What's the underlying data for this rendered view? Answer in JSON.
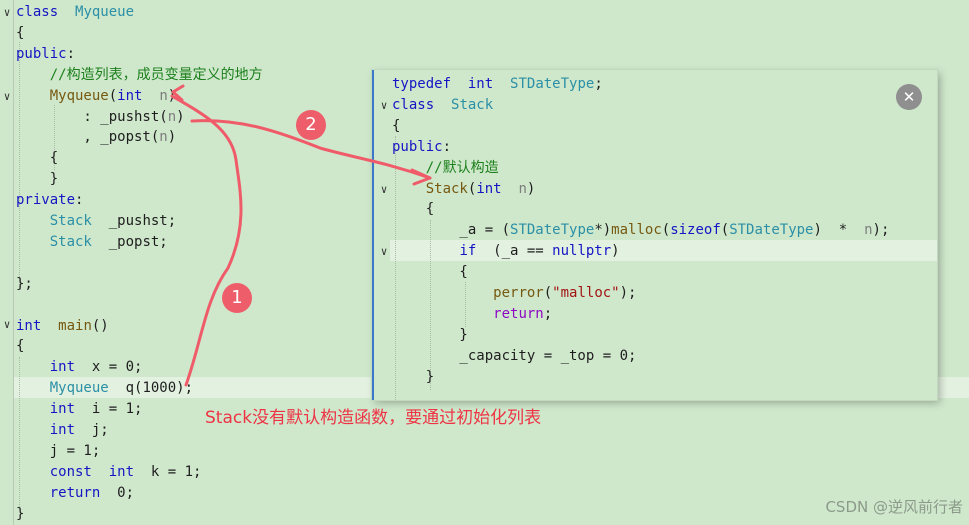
{
  "main_editor": {
    "lines": [
      {
        "parts": [
          [
            "kw",
            "class"
          ],
          [
            "",
            "  "
          ],
          [
            "ty",
            "Myqueue"
          ]
        ]
      },
      {
        "parts": [
          [
            "",
            "{"
          ]
        ]
      },
      {
        "parts": [
          [
            "kw",
            "public"
          ],
          [
            "",
            ":"
          ]
        ]
      },
      {
        "parts": [
          [
            "",
            "    "
          ],
          [
            "cm",
            "//构造列表，成员变量定义的地方"
          ]
        ]
      },
      {
        "parts": [
          [
            "",
            "    "
          ],
          [
            "fn",
            "Myqueue"
          ],
          [
            "",
            "("
          ],
          [
            "kw",
            "int"
          ],
          [
            "",
            "  "
          ],
          [
            "pr",
            "n"
          ],
          [
            "",
            ")"
          ]
        ]
      },
      {
        "parts": [
          [
            "",
            "        : _pushst("
          ],
          [
            "pr",
            "n"
          ],
          [
            "",
            ")"
          ]
        ]
      },
      {
        "parts": [
          [
            "",
            "        , _popst("
          ],
          [
            "pr",
            "n"
          ],
          [
            "",
            ")"
          ]
        ]
      },
      {
        "parts": [
          [
            "",
            "    {"
          ]
        ]
      },
      {
        "parts": [
          [
            "",
            "    }"
          ]
        ]
      },
      {
        "parts": [
          [
            "kw",
            "private"
          ],
          [
            "",
            ":"
          ]
        ]
      },
      {
        "parts": [
          [
            "",
            "    "
          ],
          [
            "ty",
            "Stack"
          ],
          [
            "",
            "  _pushst;"
          ]
        ]
      },
      {
        "parts": [
          [
            "",
            "    "
          ],
          [
            "ty",
            "Stack"
          ],
          [
            "",
            "  _popst;"
          ]
        ]
      },
      {
        "parts": [
          [
            "",
            ""
          ]
        ]
      },
      {
        "parts": [
          [
            "",
            "};"
          ]
        ]
      },
      {
        "parts": [
          [
            "",
            ""
          ]
        ]
      },
      {
        "parts": [
          [
            "kw",
            "int"
          ],
          [
            "",
            "  "
          ],
          [
            "fn",
            "main"
          ],
          [
            "",
            "()"
          ]
        ]
      },
      {
        "parts": [
          [
            "",
            "{"
          ]
        ]
      },
      {
        "parts": [
          [
            "",
            "    "
          ],
          [
            "kw",
            "int"
          ],
          [
            "",
            "  x = 0;"
          ]
        ]
      },
      {
        "parts": [
          [
            "",
            "    "
          ],
          [
            "ty",
            "Myqueue"
          ],
          [
            "",
            "  q(1000);"
          ]
        ]
      },
      {
        "parts": [
          [
            "",
            "    "
          ],
          [
            "kw",
            "int"
          ],
          [
            "",
            "  i = 1;"
          ]
        ]
      },
      {
        "parts": [
          [
            "",
            "    "
          ],
          [
            "kw",
            "int"
          ],
          [
            "",
            "  j;"
          ]
        ]
      },
      {
        "parts": [
          [
            "",
            "    j = 1;"
          ]
        ]
      },
      {
        "parts": [
          [
            "",
            "    "
          ],
          [
            "kw",
            "const"
          ],
          [
            "",
            "  "
          ],
          [
            "kw",
            "int"
          ],
          [
            "",
            "  k = 1;"
          ]
        ]
      },
      {
        "parts": [
          [
            "",
            "    "
          ],
          [
            "kw",
            "return"
          ],
          [
            "",
            "  0;"
          ]
        ]
      },
      {
        "parts": [
          [
            "",
            "}"
          ]
        ]
      }
    ]
  },
  "peek_window": {
    "lines": [
      {
        "parts": [
          [
            "kw",
            "typedef"
          ],
          [
            "",
            "  "
          ],
          [
            "kw",
            "int"
          ],
          [
            "",
            "  "
          ],
          [
            "ty",
            "STDateType"
          ],
          [
            "",
            ";"
          ]
        ]
      },
      {
        "parts": [
          [
            "kw",
            "class"
          ],
          [
            "",
            "  "
          ],
          [
            "ty",
            "Stack"
          ]
        ]
      },
      {
        "parts": [
          [
            "",
            "{"
          ]
        ]
      },
      {
        "parts": [
          [
            "kw",
            "public"
          ],
          [
            "",
            ":"
          ]
        ]
      },
      {
        "parts": [
          [
            "",
            "    "
          ],
          [
            "cm",
            "//默认构造"
          ]
        ]
      },
      {
        "parts": [
          [
            "",
            "    "
          ],
          [
            "fn",
            "Stack"
          ],
          [
            "",
            "("
          ],
          [
            "kw",
            "int"
          ],
          [
            "",
            "  "
          ],
          [
            "pr",
            "n"
          ],
          [
            "",
            ")"
          ]
        ]
      },
      {
        "parts": [
          [
            "",
            "    {"
          ]
        ]
      },
      {
        "parts": [
          [
            "",
            "        _a = ("
          ],
          [
            "ty",
            "STDateType"
          ],
          [
            "",
            "*)"
          ],
          [
            "fn",
            "malloc"
          ],
          [
            "",
            "("
          ],
          [
            "kw",
            "sizeof"
          ],
          [
            "",
            "("
          ],
          [
            "ty",
            "STDateType"
          ],
          [
            "",
            ")  *  "
          ],
          [
            "pr",
            "n"
          ],
          [
            "",
            ");"
          ]
        ]
      },
      {
        "parts": [
          [
            "",
            "        "
          ],
          [
            "kw",
            "if"
          ],
          [
            "",
            "  (_a == "
          ],
          [
            "kw",
            "nullptr"
          ],
          [
            "",
            ")"
          ]
        ]
      },
      {
        "parts": [
          [
            "",
            "        {"
          ]
        ]
      },
      {
        "parts": [
          [
            "",
            "            "
          ],
          [
            "fn",
            "perror"
          ],
          [
            "",
            "("
          ],
          [
            "st",
            "\"malloc\""
          ],
          [
            "",
            ");"
          ]
        ]
      },
      {
        "parts": [
          [
            "",
            "            "
          ],
          [
            "ct",
            "return"
          ],
          [
            "",
            ";"
          ]
        ]
      },
      {
        "parts": [
          [
            "",
            "        }"
          ]
        ]
      },
      {
        "parts": [
          [
            "",
            "        _capacity = _top = 0;"
          ]
        ]
      },
      {
        "parts": [
          [
            "",
            "    }"
          ]
        ]
      }
    ],
    "close_icon": "close-icon"
  },
  "annotations": {
    "marker_1": "1",
    "marker_2": "2",
    "note": "Stack没有默认构造函数，要通过初始化列表",
    "arrow_color": "#f05b6a"
  },
  "watermark": "CSDN @逆风前行者",
  "colors": {
    "background": "#cfe8cc",
    "keyword": "#1515c4",
    "type": "#2b8fa6",
    "function": "#76580f",
    "comment": "#1c7f1c",
    "annotation": "#ee3344",
    "peek_border": "#3a78c9"
  }
}
